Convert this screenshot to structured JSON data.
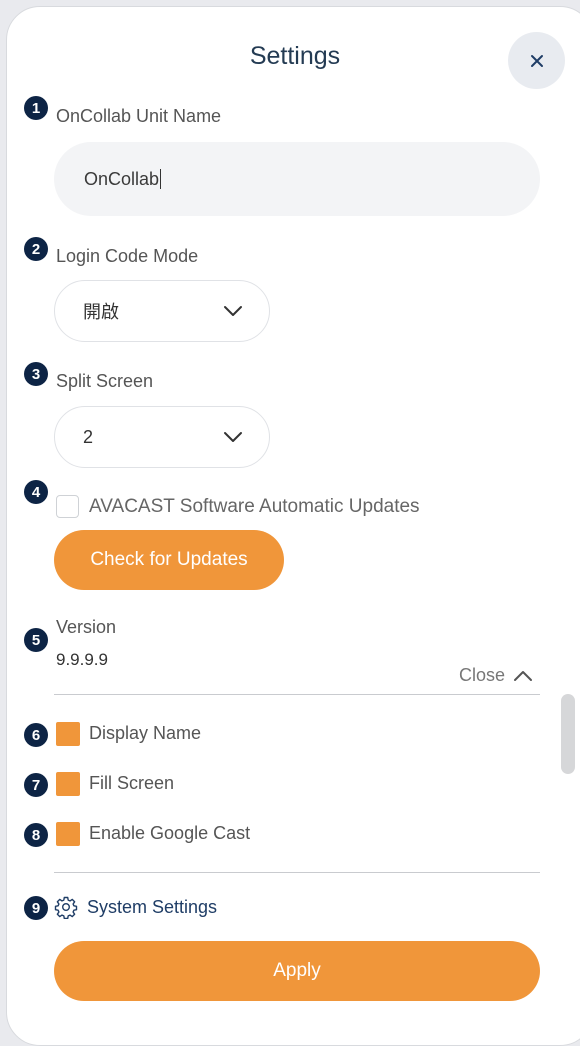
{
  "header": {
    "title": "Settings"
  },
  "unit_name": {
    "number": "1",
    "label": "OnCollab Unit Name",
    "value": "OnCollab"
  },
  "login_code": {
    "number": "2",
    "label": "Login Code Mode",
    "selected": "開啟"
  },
  "split_screen": {
    "number": "3",
    "label": "Split Screen",
    "selected": "2"
  },
  "auto_updates": {
    "number": "4",
    "label": "AVACAST Software Automatic Updates",
    "checked": false,
    "button_label": "Check for Updates"
  },
  "version": {
    "number": "5",
    "label": "Version",
    "value": "9.9.9.9",
    "toggle_label": "Close"
  },
  "options": [
    {
      "number": "6",
      "label": "Display Name",
      "checked": true
    },
    {
      "number": "7",
      "label": "Fill Screen",
      "checked": true
    },
    {
      "number": "8",
      "label": "Enable Google Cast",
      "checked": true
    }
  ],
  "system_settings": {
    "number": "9",
    "label": "System Settings"
  },
  "apply_label": "Apply",
  "colors": {
    "accent": "#f0963a",
    "badge": "#0d2445",
    "title": "#243b53"
  },
  "icons": {
    "close": "close-icon",
    "chevron": "chevron-down-icon",
    "collapse": "chevron-up-icon",
    "settings": "gear-icon"
  }
}
